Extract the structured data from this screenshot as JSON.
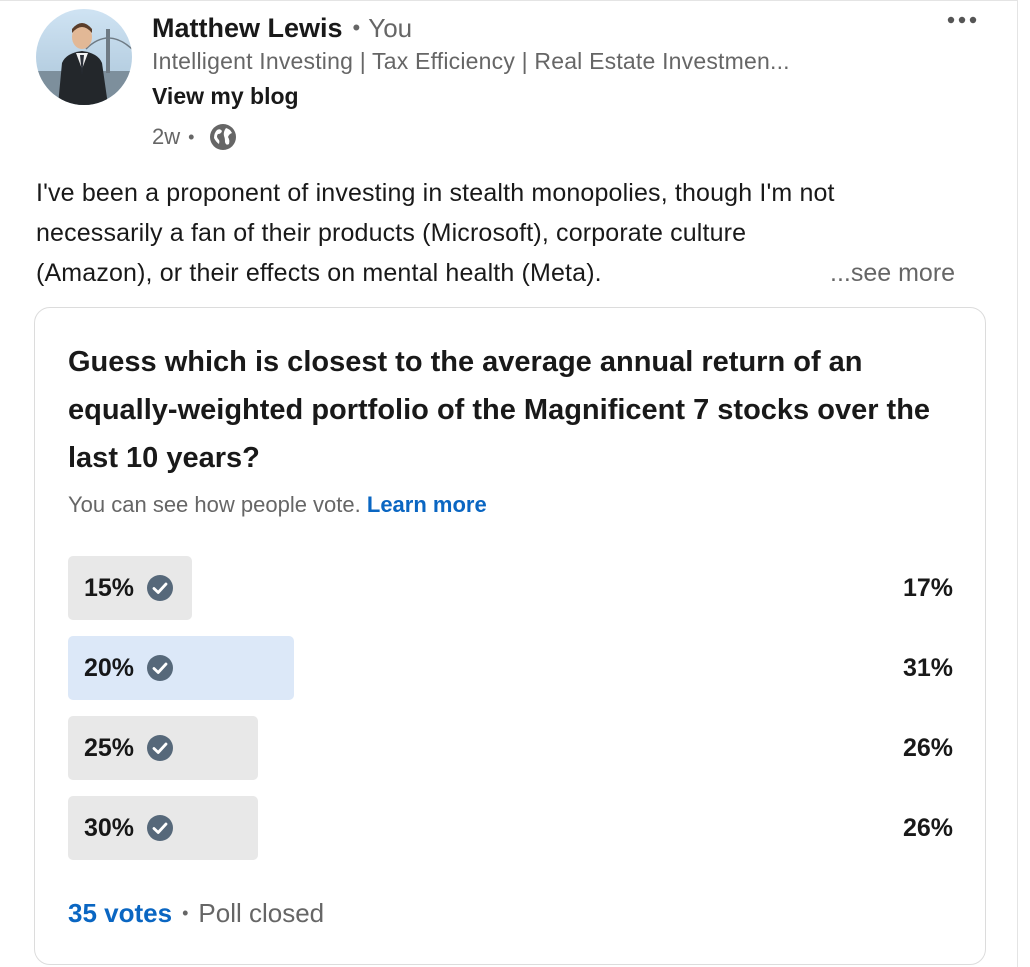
{
  "post": {
    "author": {
      "name": "Matthew Lewis",
      "relation": "You",
      "headline": "Intelligent Investing | Tax Efficiency | Real Estate Investmen...",
      "link_label": "View my blog"
    },
    "meta": {
      "age": "2w",
      "visibility_icon": "globe-icon"
    },
    "more_icon": "ellipsis-icon",
    "body_lines": [
      "I've been a proponent of investing in stealth monopolies, though I'm not",
      "necessarily a fan of their products (Microsoft), corporate culture",
      "(Amazon), or their effects on mental health (Meta)."
    ],
    "see_more_label": "...see more"
  },
  "poll": {
    "question": "Guess which is closest to the average annual return of an equally-weighted portfolio of the Magnificent 7 stocks over the last 10 years?",
    "visibility_note": "You can see how people vote.",
    "learn_more_label": "Learn more",
    "options": [
      {
        "label": "15%",
        "percent": "17%",
        "share": 0.17,
        "selected": false
      },
      {
        "label": "20%",
        "percent": "31%",
        "share": 0.31,
        "selected": true
      },
      {
        "label": "25%",
        "percent": "26%",
        "share": 0.26,
        "selected": false
      },
      {
        "label": "30%",
        "percent": "26%",
        "share": 0.26,
        "selected": false
      }
    ],
    "votes_label": "35 votes",
    "status": "Poll closed",
    "colors": {
      "accent": "#0a66c2",
      "bar": "#e8e8e8",
      "bar_selected": "#dce8f8",
      "check": "#56687a"
    }
  }
}
